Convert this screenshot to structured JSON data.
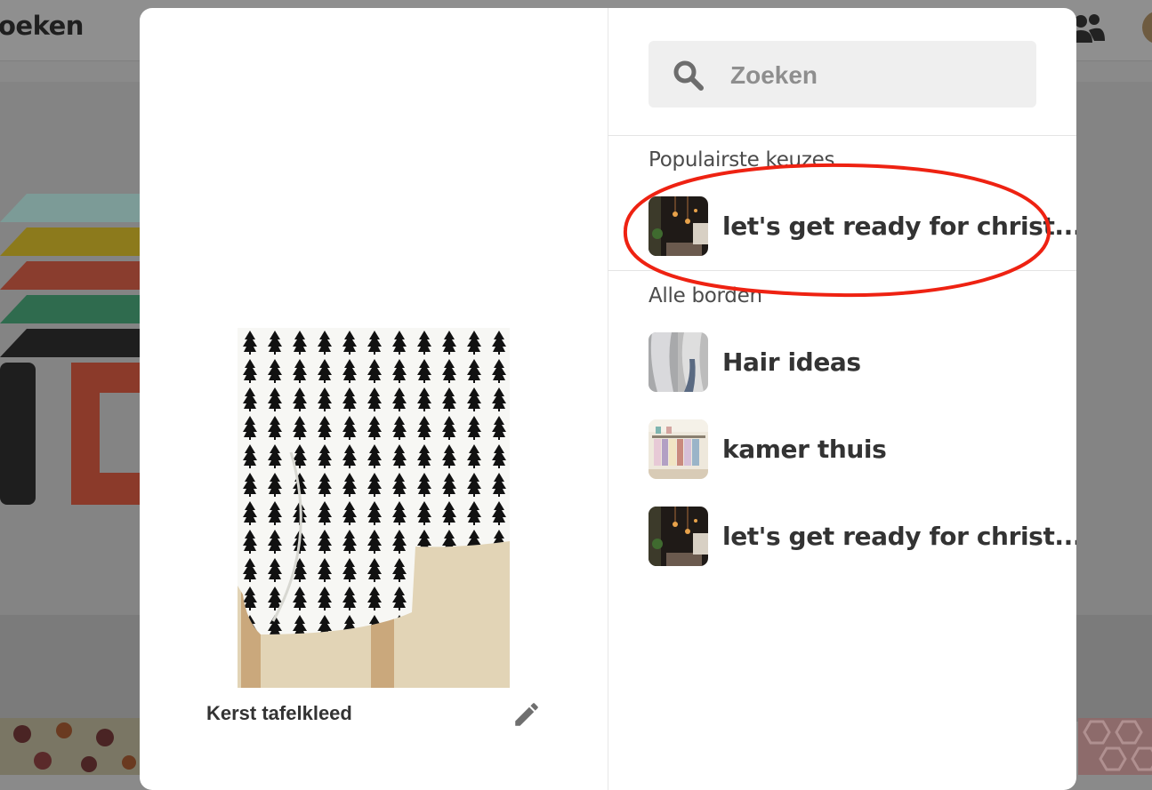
{
  "background": {
    "header_title": "oeken"
  },
  "pin": {
    "title": "Kerst tafelkleed"
  },
  "search": {
    "placeholder": "Zoeken"
  },
  "sections": {
    "popular_label": "Populairste keuzes",
    "all_label": "Alle borden"
  },
  "popular_boards": [
    {
      "name": "let's get ready for christ..."
    }
  ],
  "all_boards": [
    {
      "name": "Hair ideas"
    },
    {
      "name": "kamer thuis"
    },
    {
      "name": "let's get ready for christ..."
    }
  ],
  "colors": {
    "annotation": "#ee2212",
    "overlay": "#8a8a8a"
  }
}
